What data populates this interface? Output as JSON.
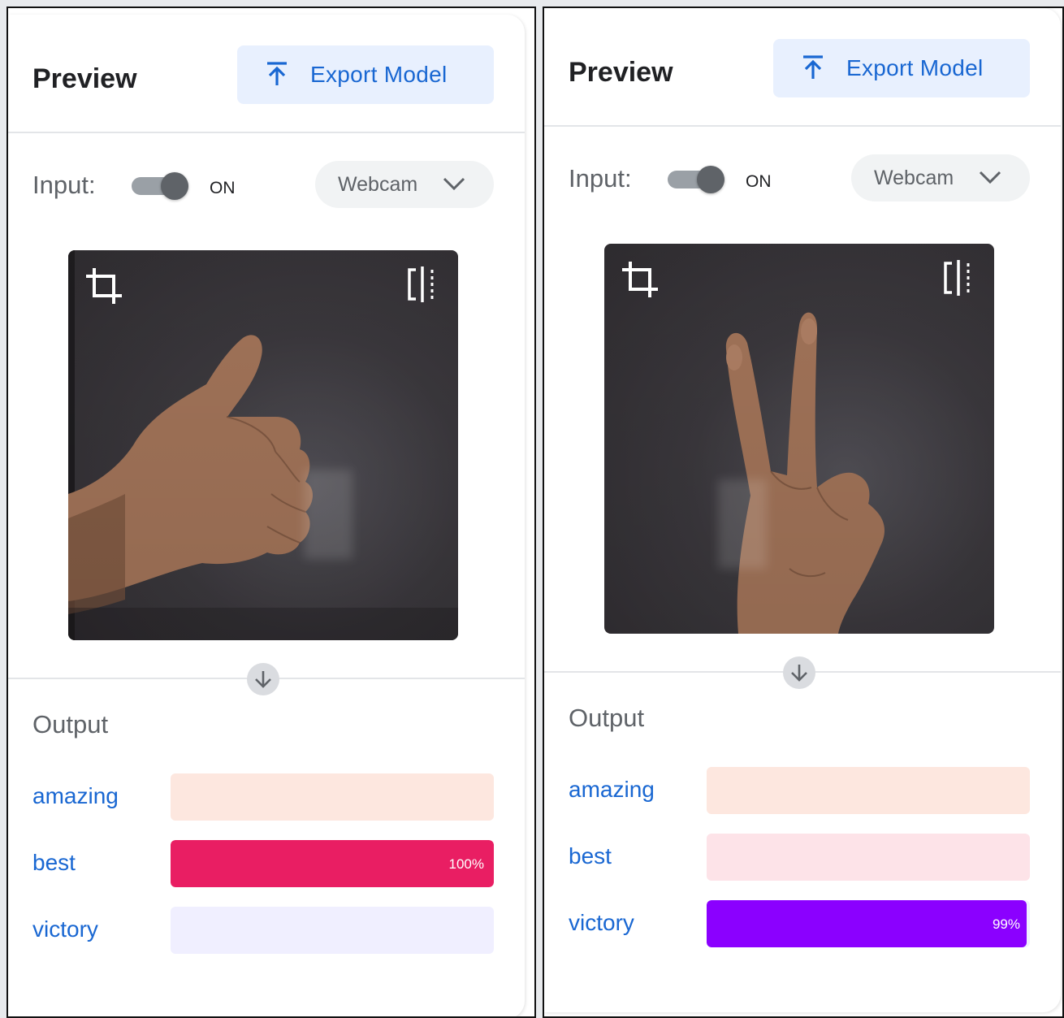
{
  "panels": [
    {
      "title": "Preview",
      "export_label": "Export Model",
      "input_label": "Input:",
      "toggle_state": "ON",
      "source": "Webcam",
      "output_title": "Output",
      "classes": [
        {
          "label": "amazing",
          "track_color": "#fde7df",
          "fill_color": "#fcd9cc",
          "percent": 0,
          "percent_label": ""
        },
        {
          "label": "best",
          "track_color": "#fde3e8",
          "fill_color": "#e91e63",
          "percent": 100,
          "percent_label": "100%"
        },
        {
          "label": "victory",
          "track_color": "#f0efff",
          "fill_color": "#8e24aa",
          "percent": 0,
          "percent_label": ""
        }
      ],
      "gesture": "thumbs-up"
    },
    {
      "title": "Preview",
      "export_label": "Export Model",
      "input_label": "Input:",
      "toggle_state": "ON",
      "source": "Webcam",
      "output_title": "Output",
      "classes": [
        {
          "label": "amazing",
          "track_color": "#fde7df",
          "fill_color": "#fcd9cc",
          "percent": 0,
          "percent_label": ""
        },
        {
          "label": "best",
          "track_color": "#fde3e8",
          "fill_color": "#e91e63",
          "percent": 0,
          "percent_label": ""
        },
        {
          "label": "victory",
          "track_color": "#f0efff",
          "fill_color": "#8b00ff",
          "percent": 99,
          "percent_label": "99%"
        }
      ],
      "gesture": "victory"
    }
  ],
  "icons": {
    "export": "upload-icon",
    "chevron": "chevron-down-icon",
    "crop": "crop-icon",
    "flip": "flip-horizontal-icon",
    "arrow": "arrow-down-icon"
  }
}
